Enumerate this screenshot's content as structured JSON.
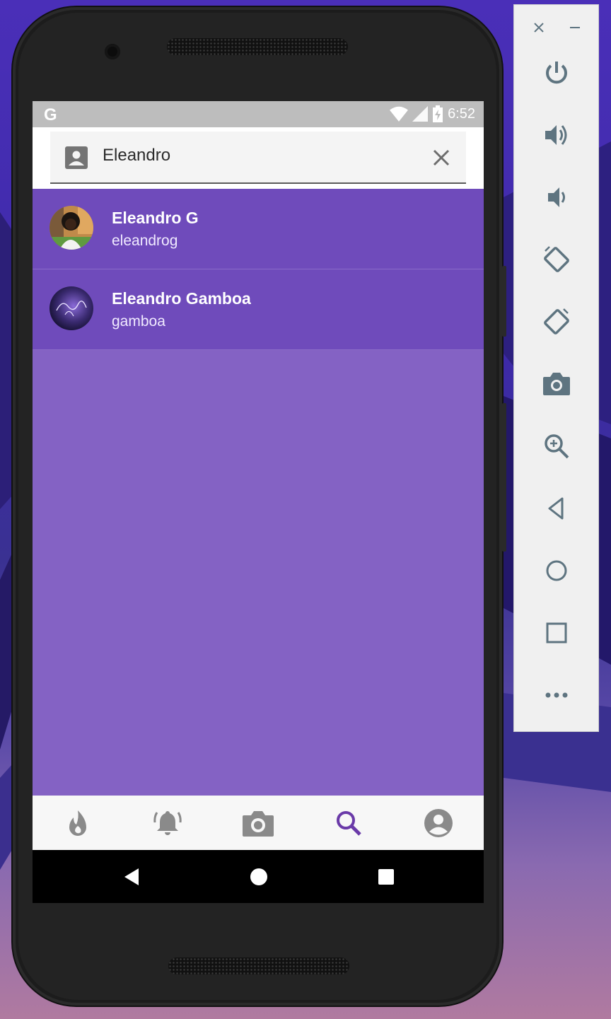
{
  "status_bar": {
    "carrier_glyph": "G",
    "time": "6:52",
    "icons": [
      "wifi-icon",
      "signal-icon",
      "battery-charging-icon"
    ]
  },
  "search": {
    "query": "Eleandro",
    "leading_icon": "contact-icon",
    "clear_icon": "close-icon"
  },
  "results": [
    {
      "name": "Eleandro G",
      "username": "eleandrog",
      "avatar": "avatar-photo"
    },
    {
      "name": "Eleandro Gamboa",
      "username": "gamboa",
      "avatar": "avatar-signature"
    }
  ],
  "bottom_nav": {
    "items": [
      {
        "icon": "flame-icon",
        "active": false
      },
      {
        "icon": "bell-icon",
        "active": false
      },
      {
        "icon": "camera-icon",
        "active": false
      },
      {
        "icon": "search-icon",
        "active": true
      },
      {
        "icon": "account-icon",
        "active": false
      }
    ],
    "active_color": "#6a3aa8",
    "inactive_color": "#8a8a8a"
  },
  "system_nav": [
    "back-icon",
    "home-icon",
    "recents-icon"
  ],
  "emulator_toolbar": {
    "window_controls": [
      "close-icon",
      "minimize-icon"
    ],
    "buttons": [
      "power-icon",
      "volume-up-icon",
      "volume-down-icon",
      "rotate-left-icon",
      "rotate-right-icon",
      "screenshot-icon",
      "zoom-icon",
      "back-icon",
      "home-icon",
      "overview-icon",
      "more-icon"
    ]
  },
  "colors": {
    "list_background": "#8462c4",
    "row_background": "#6f4bbb",
    "toolbar_icon": "#5e7480"
  }
}
